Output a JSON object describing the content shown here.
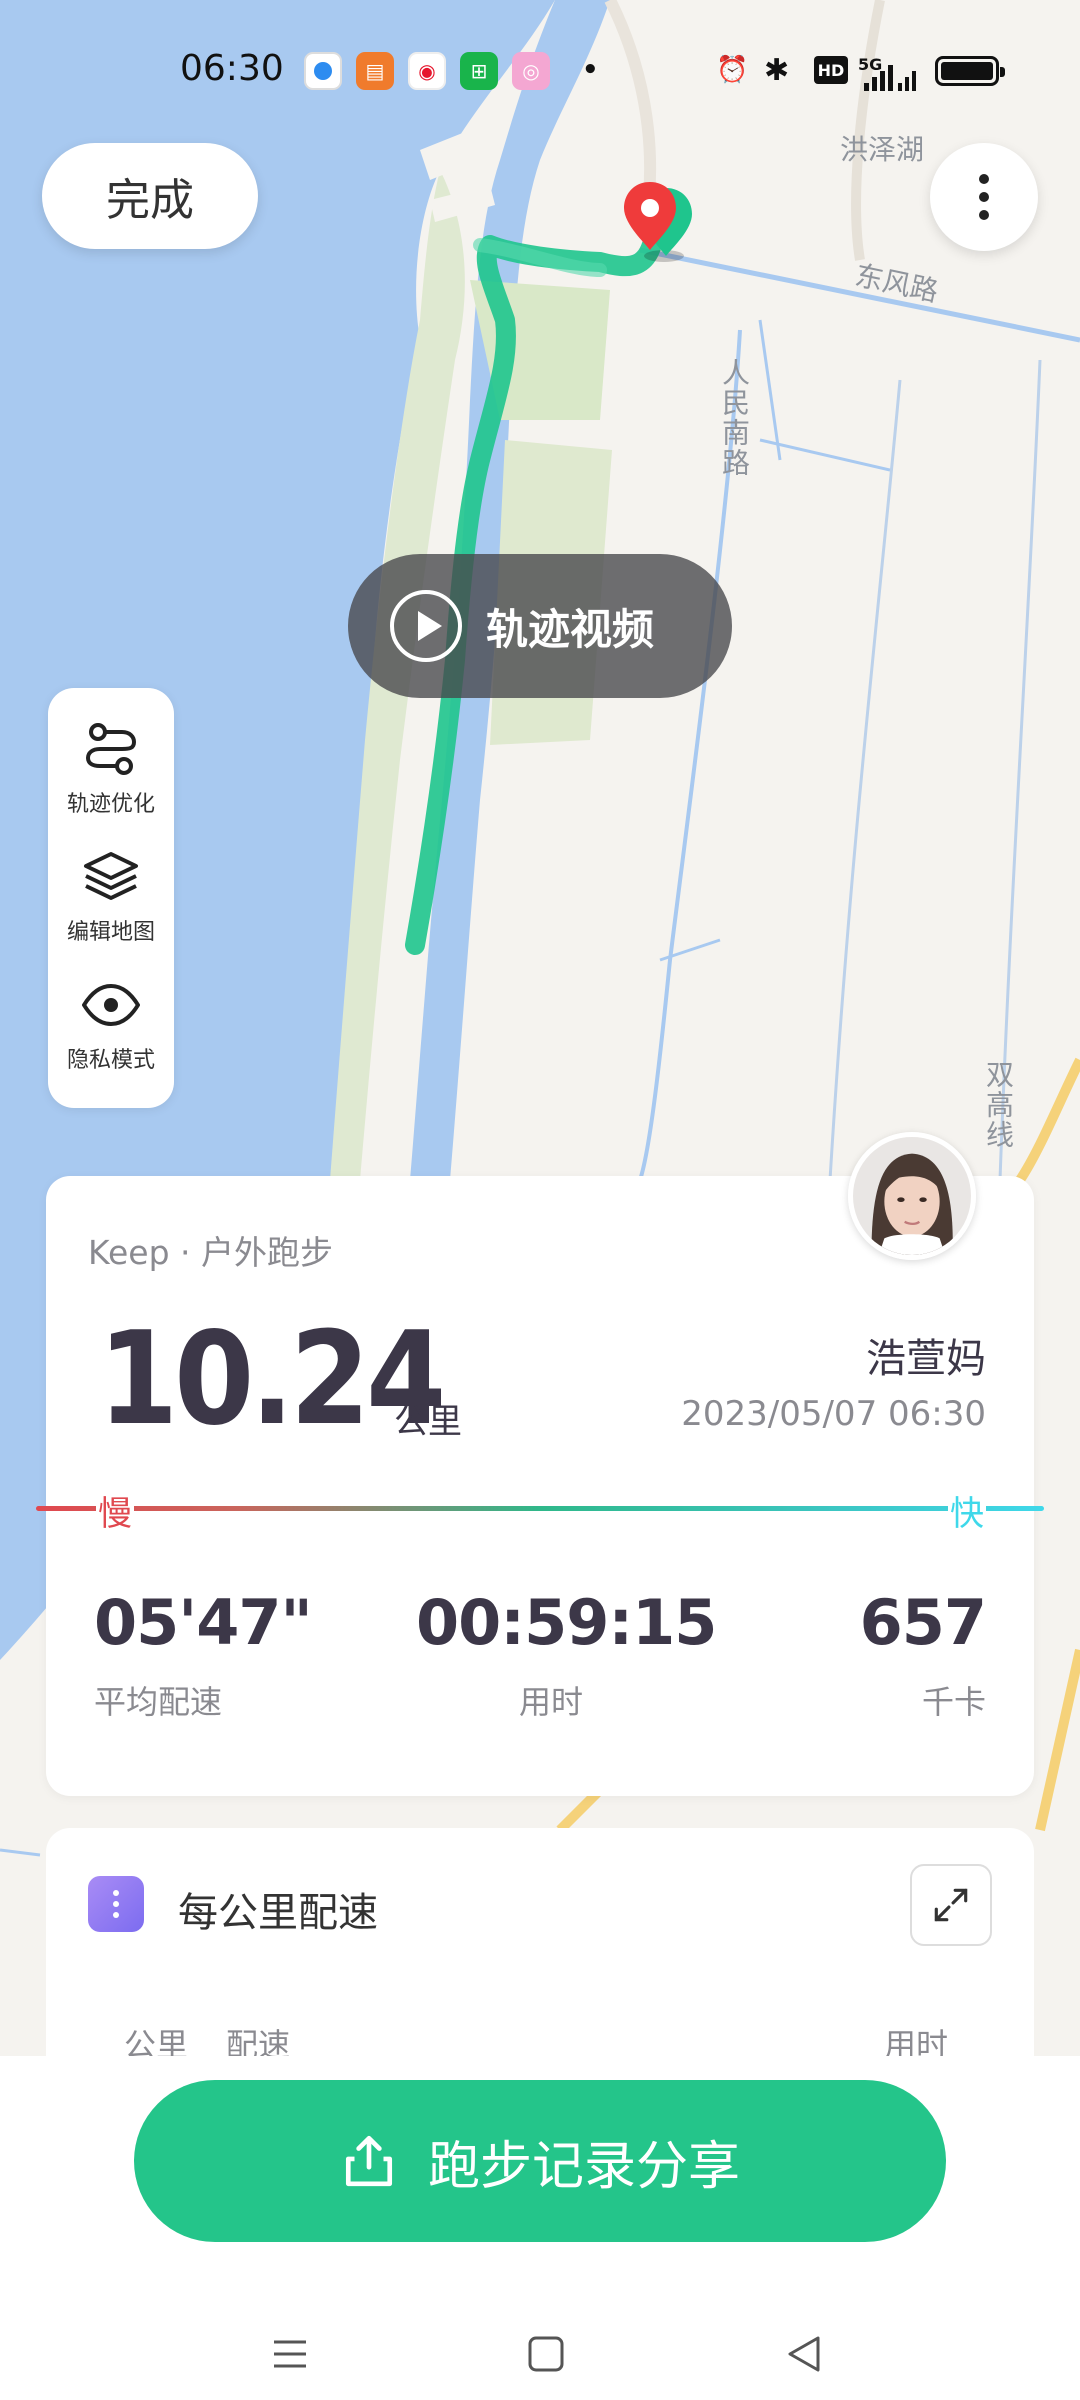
{
  "status_bar": {
    "time": "06:30",
    "app_icons": [
      "browser-icon",
      "reader-icon",
      "weibo-icon",
      "wechat-mini-icon",
      "camera-icon"
    ],
    "network": "5G",
    "hd": "HD"
  },
  "header": {
    "done_label": "完成"
  },
  "map": {
    "labels": {
      "hongzehu": "洪泽湖",
      "dongfeng_road": "东风路",
      "renmin_south": "人民南路",
      "shuanggao": "双高线"
    },
    "track_video_label": "轨迹视频",
    "tools": [
      {
        "label": "轨迹优化",
        "icon": "route-icon"
      },
      {
        "label": "编辑地图",
        "icon": "layers-icon"
      },
      {
        "label": "隐私模式",
        "icon": "eye-icon"
      }
    ],
    "route_color": "#1fc58d"
  },
  "summary": {
    "source": "Keep · 户外跑步",
    "distance": "10.24",
    "distance_unit": "公里",
    "user_name": "浩萱妈",
    "datetime": "2023/05/07 06:30",
    "slow_label": "慢",
    "fast_label": "快",
    "stats": {
      "pace": {
        "value": "05'47\"",
        "label": "平均配速"
      },
      "duration": {
        "value": "00:59:15",
        "label": "用时"
      },
      "calories": {
        "value": "657",
        "label": "千卡"
      }
    }
  },
  "per_km": {
    "title": "每公里配速",
    "columns": [
      "公里",
      "配速",
      "用时"
    ]
  },
  "share": {
    "label": "跑步记录分享",
    "color": "#24c58a"
  }
}
